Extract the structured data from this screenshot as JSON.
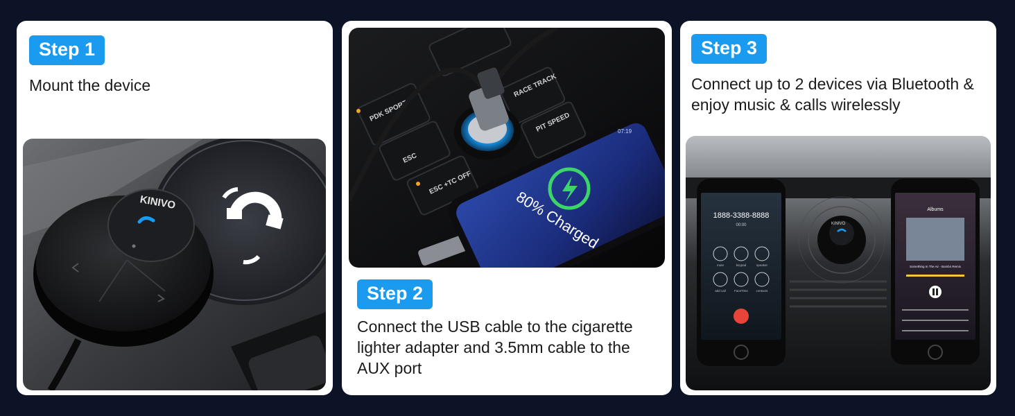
{
  "steps": [
    {
      "badge": "Step 1",
      "description": "Mount the device",
      "image": {
        "device_brand": "KINIVO"
      }
    },
    {
      "badge": "Step 2",
      "description": "Connect the USB cable to the cigarette lighter adapter and 3.5mm cable to the AUX port",
      "image": {
        "phone_status": "80% Charged",
        "phone_time": "07:19",
        "buttons": [
          "PDK SPORT",
          "ESC",
          "ESC +TC OFF",
          "RACE TRACK",
          "PIT SPEED"
        ]
      }
    },
    {
      "badge": "Step 3",
      "description": "Connect up to 2 devices via Bluetooth & enjoy music & calls wirelessly",
      "image": {
        "left_phone": {
          "number": "1888-3388-8888",
          "timer": "00:00",
          "keys": [
            "mute",
            "keypad",
            "speaker",
            "add call",
            "FaceTime",
            "contacts"
          ]
        },
        "right_phone": {
          "header": "Albums",
          "now_playing": "Something In The Air - Bombs Remix"
        },
        "device_brand": "KINIVO"
      }
    }
  ],
  "colors": {
    "background": "#0d1326",
    "badge": "#1a9bf0",
    "card": "#ffffff",
    "text": "#1b1b1b"
  }
}
